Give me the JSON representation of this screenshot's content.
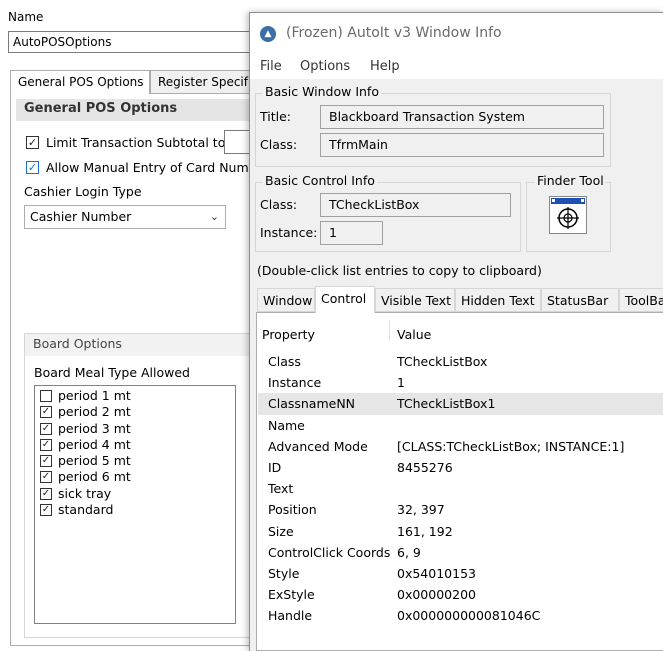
{
  "background_app": {
    "name_label": "Name",
    "name_value": "AutoPOSOptions",
    "tabs": [
      "General POS Options",
      "Register Specif"
    ],
    "section_header": "General POS Options",
    "limit_label": "Limit Transaction Subtotal to",
    "allow_label": "Allow Manual Entry of Card Numbe",
    "cashier_login_label": "Cashier Login Type",
    "cashier_login_value": "Cashier Number",
    "board_options_header": "Board Options",
    "board_meal_label": "Board Meal Type Allowed",
    "meal_types": [
      {
        "label": "period 1 mt",
        "checked": false
      },
      {
        "label": "period 2 mt",
        "checked": true
      },
      {
        "label": "period 3 mt",
        "checked": true
      },
      {
        "label": "period 4 mt",
        "checked": true
      },
      {
        "label": "period 5 mt",
        "checked": true
      },
      {
        "label": "period 6 mt",
        "checked": true
      },
      {
        "label": "sick tray",
        "checked": true
      },
      {
        "label": "standard",
        "checked": true
      }
    ]
  },
  "window_info": {
    "title": "(Frozen) AutoIt v3 Window Info",
    "menu": [
      "File",
      "Options",
      "Help"
    ],
    "basic_window": {
      "group": "Basic Window Info",
      "title_label": "Title:",
      "title_value": "Blackboard Transaction System",
      "class_label": "Class:",
      "class_value": "TfrmMain"
    },
    "basic_control": {
      "group": "Basic Control Info",
      "class_label": "Class:",
      "class_value": "TCheckListBox",
      "instance_label": "Instance:",
      "instance_value": "1"
    },
    "finder_tool": "Finder Tool",
    "hint": "(Double-click list entries to copy to clipboard)",
    "tabs": [
      "Window",
      "Control",
      "Visible Text",
      "Hidden Text",
      "StatusBar",
      "ToolBa"
    ],
    "active_tab": "Control",
    "columns": [
      "Property",
      "Value"
    ],
    "properties": [
      {
        "key": "Class",
        "value": "TCheckListBox"
      },
      {
        "key": "Instance",
        "value": "1"
      },
      {
        "key": "ClassnameNN",
        "value": "TCheckListBox1"
      },
      {
        "key": "Name",
        "value": ""
      },
      {
        "key": "Advanced Mode",
        "value": "[CLASS:TCheckListBox; INSTANCE:1]"
      },
      {
        "key": "ID",
        "value": "8455276"
      },
      {
        "key": "Text",
        "value": ""
      },
      {
        "key": "Position",
        "value": "32, 397"
      },
      {
        "key": "Size",
        "value": "161, 192"
      },
      {
        "key": "ControlClick Coords",
        "value": "6, 9"
      },
      {
        "key": "Style",
        "value": "0x54010153"
      },
      {
        "key": "ExStyle",
        "value": "0x00000200"
      },
      {
        "key": "Handle",
        "value": "0x000000000081046C"
      }
    ],
    "highlighted_row": "ClassnameNN"
  }
}
